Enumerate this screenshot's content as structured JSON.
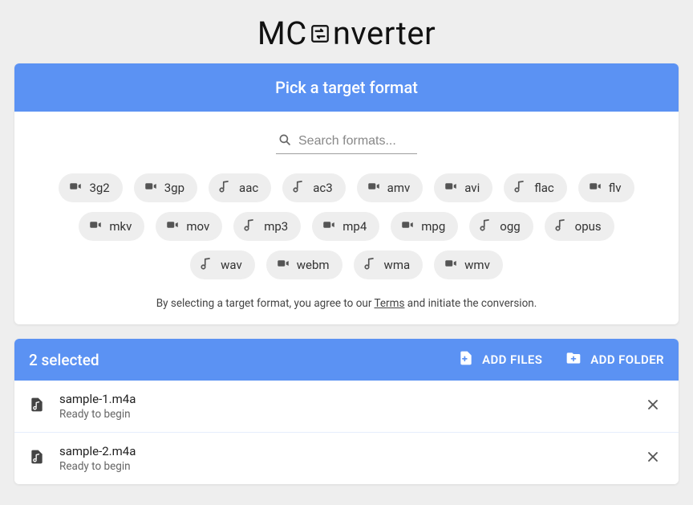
{
  "logo": {
    "pre": "MC",
    "post": "nverter"
  },
  "picker": {
    "title": "Pick a target format",
    "search_placeholder": "Search formats...",
    "formats": [
      {
        "label": "3g2",
        "kind": "video"
      },
      {
        "label": "3gp",
        "kind": "video"
      },
      {
        "label": "aac",
        "kind": "audio"
      },
      {
        "label": "ac3",
        "kind": "audio"
      },
      {
        "label": "amv",
        "kind": "video"
      },
      {
        "label": "avi",
        "kind": "video"
      },
      {
        "label": "flac",
        "kind": "audio"
      },
      {
        "label": "flv",
        "kind": "video"
      },
      {
        "label": "mkv",
        "kind": "video"
      },
      {
        "label": "mov",
        "kind": "video"
      },
      {
        "label": "mp3",
        "kind": "audio"
      },
      {
        "label": "mp4",
        "kind": "video"
      },
      {
        "label": "mpg",
        "kind": "video"
      },
      {
        "label": "ogg",
        "kind": "audio"
      },
      {
        "label": "opus",
        "kind": "audio"
      },
      {
        "label": "wav",
        "kind": "audio"
      },
      {
        "label": "webm",
        "kind": "video"
      },
      {
        "label": "wma",
        "kind": "audio"
      },
      {
        "label": "wmv",
        "kind": "video"
      }
    ],
    "terms_pre": "By selecting a target format, you agree to our ",
    "terms_link": "Terms",
    "terms_post": " and initiate the conversion."
  },
  "files": {
    "count_label": "2 selected",
    "add_files_label": "ADD FILES",
    "add_folder_label": "ADD FOLDER",
    "items": [
      {
        "name": "sample-1.m4a",
        "status": "Ready to begin"
      },
      {
        "name": "sample-2.m4a",
        "status": "Ready to begin"
      }
    ]
  },
  "colors": {
    "accent": "#5b92f3",
    "chip_bg": "#eeeeee"
  }
}
